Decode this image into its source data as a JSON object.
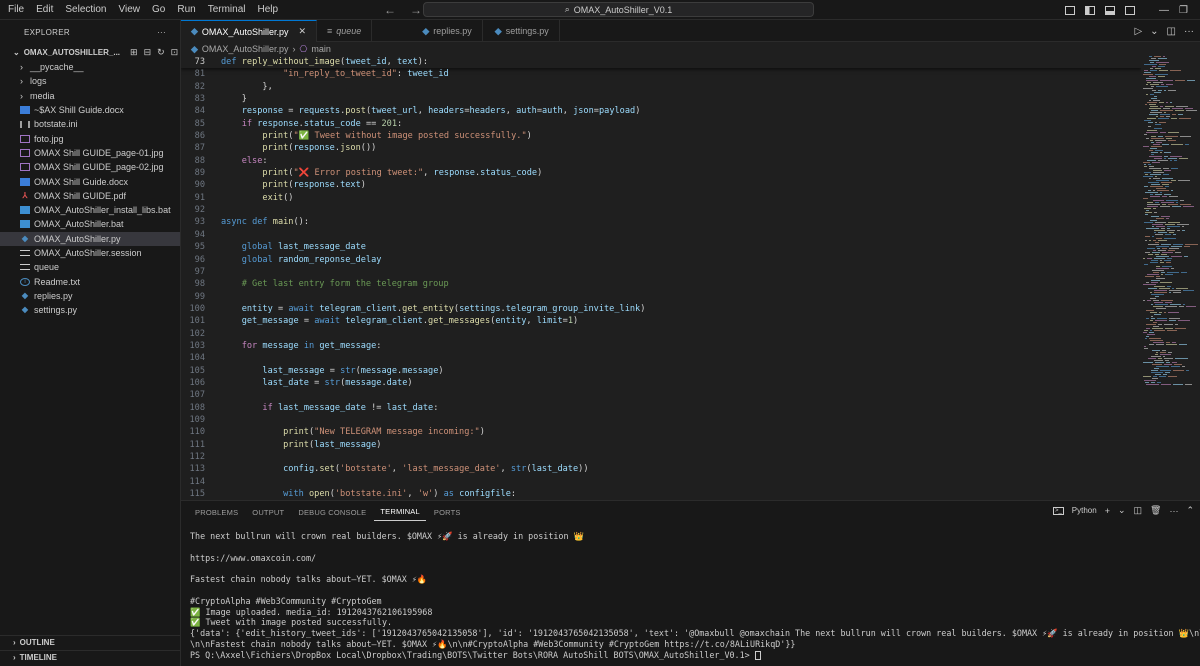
{
  "menu": [
    "File",
    "Edit",
    "Selection",
    "View",
    "Go",
    "Run",
    "Terminal",
    "Help"
  ],
  "command_center": {
    "text": "OMAX_AutoShiller_V0.1"
  },
  "sidebar": {
    "title": "EXPLORER",
    "more": "···",
    "root": "OMAX_AUTOSHILLER_...",
    "items": [
      {
        "label": "__pycache__",
        "kind": "folder",
        "icon": "chevron-right-icon"
      },
      {
        "label": "logs",
        "kind": "folder",
        "icon": "chevron-right-icon"
      },
      {
        "label": "media",
        "kind": "folder",
        "icon": "chevron-right-icon"
      },
      {
        "label": "~$AX Shill Guide.docx",
        "kind": "file",
        "icon": "word-doc-icon"
      },
      {
        "label": "botstate.ini",
        "kind": "file",
        "icon": "ini-file-icon"
      },
      {
        "label": "foto.jpg",
        "kind": "file",
        "icon": "image-file-icon"
      },
      {
        "label": "OMAX Shill GUIDE_page-01.jpg",
        "kind": "file",
        "icon": "image-file-icon"
      },
      {
        "label": "OMAX Shill GUIDE_page-02.jpg",
        "kind": "file",
        "icon": "image-file-icon"
      },
      {
        "label": "OMAX Shill Guide.docx",
        "kind": "file",
        "icon": "word-doc-icon"
      },
      {
        "label": "OMAX Shill GUIDE.pdf",
        "kind": "file",
        "icon": "pdf-file-icon"
      },
      {
        "label": "OMAX_AutoShiller_install_libs.bat",
        "kind": "file",
        "icon": "bat-file-icon"
      },
      {
        "label": "OMAX_AutoShiller.bat",
        "kind": "file",
        "icon": "bat-file-icon"
      },
      {
        "label": "OMAX_AutoShiller.py",
        "kind": "file",
        "icon": "python-file-icon",
        "active": true
      },
      {
        "label": "OMAX_AutoShiller.session",
        "kind": "file",
        "icon": "session-file-icon"
      },
      {
        "label": "queue",
        "kind": "file",
        "icon": "list-file-icon"
      },
      {
        "label": "Readme.txt",
        "kind": "file",
        "icon": "info-file-icon"
      },
      {
        "label": "replies.py",
        "kind": "file",
        "icon": "python-file-icon"
      },
      {
        "label": "settings.py",
        "kind": "file",
        "icon": "python-file-icon"
      }
    ],
    "outline": "OUTLINE",
    "timeline": "TIMELINE"
  },
  "tabs": [
    {
      "label": "OMAX_AutoShiller.py",
      "active": true,
      "close": "✕"
    },
    {
      "label": "queue",
      "active": false
    },
    {
      "label": "replies.py",
      "active": false
    },
    {
      "label": "settings.py",
      "active": false
    }
  ],
  "breadcrumb": {
    "file": "OMAX_AutoShiller.py",
    "symbol": "main"
  },
  "code": {
    "sticky": {
      "num": "73",
      "text": "def reply_without_image(tweet_id, text):"
    },
    "lines": [
      {
        "num": "81",
        "text": "            \"in_reply_to_tweet_id\": tweet_id"
      },
      {
        "num": "82",
        "text": "        },"
      },
      {
        "num": "83",
        "text": "    }"
      },
      {
        "num": "84",
        "text": "    response = requests.post(tweet_url, headers=headers, auth=auth, json=payload)"
      },
      {
        "num": "85",
        "text": "    if response.status_code == 201:"
      },
      {
        "num": "86",
        "text": "        print(\"✅ Tweet without image posted successfully.\")"
      },
      {
        "num": "87",
        "text": "        print(response.json())"
      },
      {
        "num": "88",
        "text": "    else:"
      },
      {
        "num": "89",
        "text": "        print(\"❌ Error posting tweet:\", response.status_code)"
      },
      {
        "num": "90",
        "text": "        print(response.text)"
      },
      {
        "num": "91",
        "text": "        exit()"
      },
      {
        "num": "92",
        "text": ""
      },
      {
        "num": "93",
        "text": "async def main():"
      },
      {
        "num": "94",
        "text": ""
      },
      {
        "num": "95",
        "text": "    global last_message_date"
      },
      {
        "num": "96",
        "text": "    global random_reponse_delay"
      },
      {
        "num": "97",
        "text": ""
      },
      {
        "num": "98",
        "text": "    # Get last entry form the telegram group"
      },
      {
        "num": "99",
        "text": ""
      },
      {
        "num": "100",
        "text": "    entity = await telegram_client.get_entity(settings.telegram_group_invite_link)"
      },
      {
        "num": "101",
        "text": "    get_message = await telegram_client.get_messages(entity, limit=1)"
      },
      {
        "num": "102",
        "text": ""
      },
      {
        "num": "103",
        "text": "    for message in get_message:"
      },
      {
        "num": "104",
        "text": ""
      },
      {
        "num": "105",
        "text": "        last_message = str(message.message)"
      },
      {
        "num": "106",
        "text": "        last_date = str(message.date)"
      },
      {
        "num": "107",
        "text": ""
      },
      {
        "num": "108",
        "text": "        if last_message_date != last_date:"
      },
      {
        "num": "109",
        "text": ""
      },
      {
        "num": "110",
        "text": "            print(\"New TELEGRAM message incoming:\")"
      },
      {
        "num": "111",
        "text": "            print(last_message)"
      },
      {
        "num": "112",
        "text": ""
      },
      {
        "num": "113",
        "text": "            config.set('botstate', 'last_message_date', str(last_date))"
      },
      {
        "num": "114",
        "text": ""
      },
      {
        "num": "115",
        "text": "            with open('botstate.ini', 'w') as configfile:"
      }
    ]
  },
  "panel": {
    "tabs": [
      "PROBLEMS",
      "OUTPUT",
      "DEBUG CONSOLE",
      "TERMINAL",
      "PORTS"
    ],
    "active_tab": "TERMINAL",
    "shell": "Python",
    "terminal_lines": [
      "The next bullrun will crown real builders. $OMAX ⚡🚀 is already in position 👑",
      "",
      "https://www.omaxcoin.com/",
      "",
      "Fastest chain nobody talks about—YET. $OMAX ⚡🔥",
      "",
      "#CryptoAlpha #Web3Community #CryptoGem",
      "✅ Image uploaded. media_id: 1912043762106195968",
      "✅ Tweet with image posted successfully.",
      "{'data': {'edit_history_tweet_ids': ['1912043765042135058'], 'id': '1912043765042135058', 'text': '@Omaxbull @omaxchain The next bullrun will crown real builders. $OMAX ⚡🚀 is already in position 👑\\n\\nhttps://t.co/qctYiVf",
      "\\n\\nFastest chain nobody talks about—YET. $OMAX ⚡🔥\\n\\n#CryptoAlpha #Web3Community #CryptoGem https://t.co/8ALiURikqD'}}",
      "PS Q:\\Axxel\\Fichiers\\DropBox Local\\Dropbox\\Trading\\BOTS\\Twitter Bots\\RORA AutoShill BOTS\\OMAX_AutoShiller_V0.1> "
    ]
  },
  "colors": {
    "keyword": "#569cd6",
    "control": "#c586c0",
    "function": "#dcdcaa",
    "variable": "#9cdcfe",
    "string": "#ce9178",
    "number": "#b5cea8",
    "comment": "#6a9955",
    "accent": "#0078d4"
  }
}
